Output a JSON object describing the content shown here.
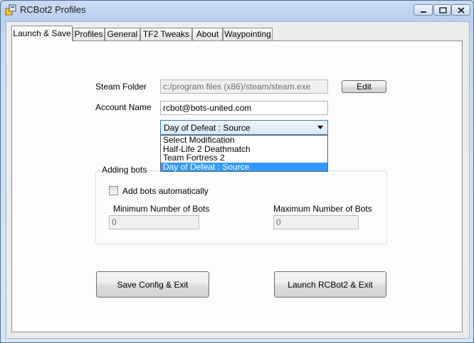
{
  "window": {
    "title": "RCBot2 Profiles"
  },
  "tabs": [
    {
      "label": "Launch & Save",
      "active": true
    },
    {
      "label": "Profiles"
    },
    {
      "label": "General"
    },
    {
      "label": "TF2 Tweaks"
    },
    {
      "label": "About"
    },
    {
      "label": "Waypointing"
    }
  ],
  "launch": {
    "steam_folder_label": "Steam Folder",
    "steam_folder_value": "c:/program files (x86)/steam/steam.exe",
    "edit_label": "Edit",
    "account_name_label": "Account Name",
    "account_name_value": "rcbot@bots-united.com",
    "mod_selected": "Day of Defeat : Source",
    "mod_options": [
      "Select Modification",
      "Half-Life 2 Deathmatch",
      "Team Fortress 2",
      "Day of Defeat : Source"
    ]
  },
  "adding_bots": {
    "legend": "Adding bots",
    "auto_label": "Add bots automatically",
    "auto_checked": false,
    "min_label": "Minimum Number of Bots",
    "min_value": "0",
    "max_label": "Maximum Number of Bots",
    "max_value": "0"
  },
  "buttons": {
    "save": "Save Config & Exit",
    "launch": "Launch RCBot2 & Exit"
  },
  "colors": {
    "selection": "#3399ff",
    "combo_border": "#3c7fb1"
  }
}
